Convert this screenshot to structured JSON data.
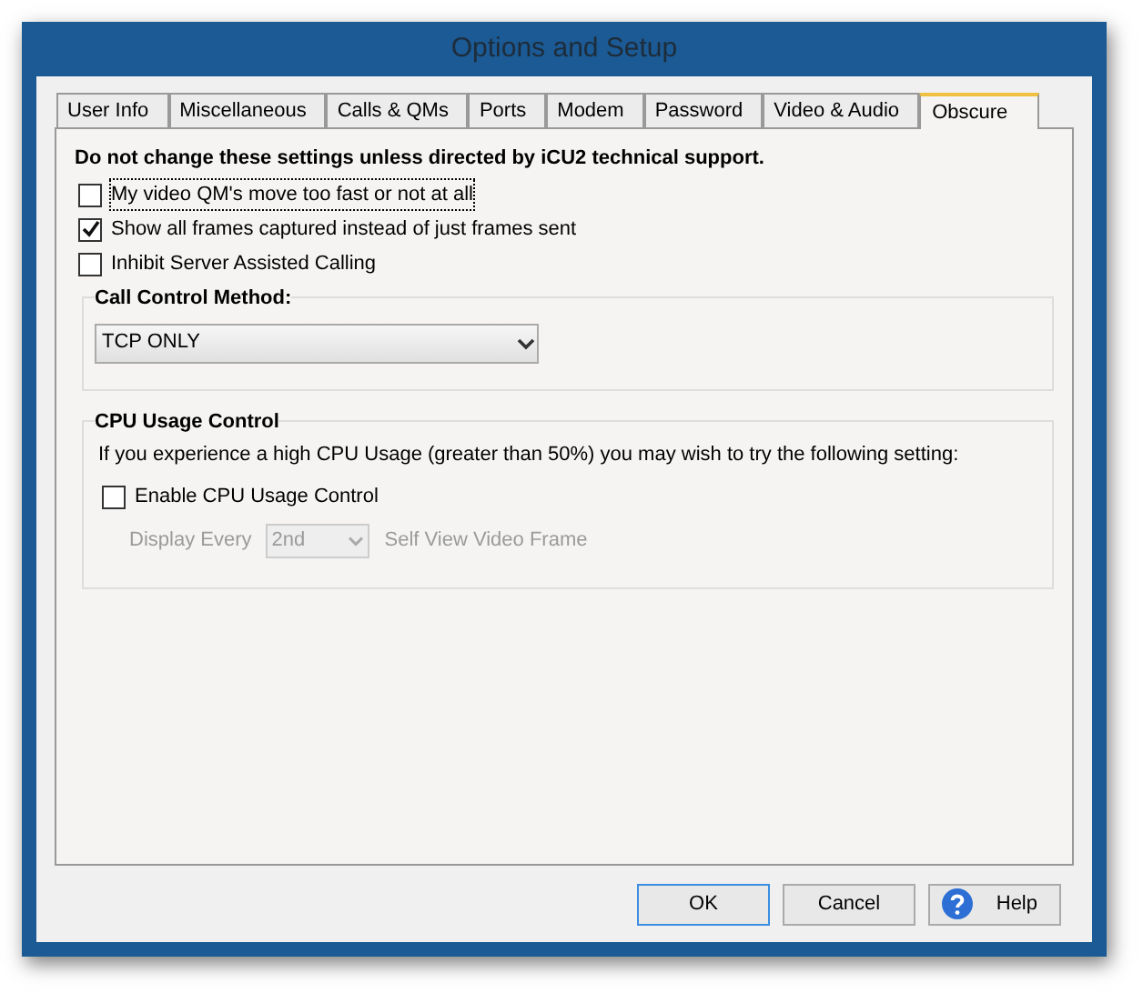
{
  "window": {
    "title": "Options and Setup"
  },
  "tabs": [
    {
      "label": "User Info",
      "selected": false
    },
    {
      "label": "Miscellaneous",
      "selected": false
    },
    {
      "label": "Calls & QMs",
      "selected": false
    },
    {
      "label": "Ports",
      "selected": false
    },
    {
      "label": "Modem",
      "selected": false
    },
    {
      "label": "Password",
      "selected": false
    },
    {
      "label": "Video & Audio",
      "selected": false
    },
    {
      "label": "Obscure",
      "selected": true
    }
  ],
  "warning": "Do not change these settings unless directed by iCU2 technical support.",
  "options": [
    {
      "label": "My video QM's move too fast or not at all",
      "checked": false,
      "focused": true
    },
    {
      "label": "Show all frames captured instead of just frames sent",
      "checked": true,
      "focused": false
    },
    {
      "label": "Inhibit Server Assisted Calling",
      "checked": false,
      "focused": false
    }
  ],
  "call_control": {
    "title": "Call Control Method:",
    "value": "TCP ONLY"
  },
  "cpu_usage": {
    "title": "CPU Usage Control",
    "description": "If you experience a high CPU  Usage (greater than 50%) you may wish to try the following setting:",
    "checkbox": {
      "label": "Enable CPU Usage Control",
      "checked": false
    },
    "display_every": {
      "label": "Display Every",
      "value": "2nd",
      "suffix": "Self View Video Frame",
      "disabled": true
    }
  },
  "buttons": [
    {
      "label": "OK",
      "kind": "default"
    },
    {
      "label": "Cancel",
      "kind": "plain"
    },
    {
      "label": "Help",
      "kind": "help"
    }
  ]
}
